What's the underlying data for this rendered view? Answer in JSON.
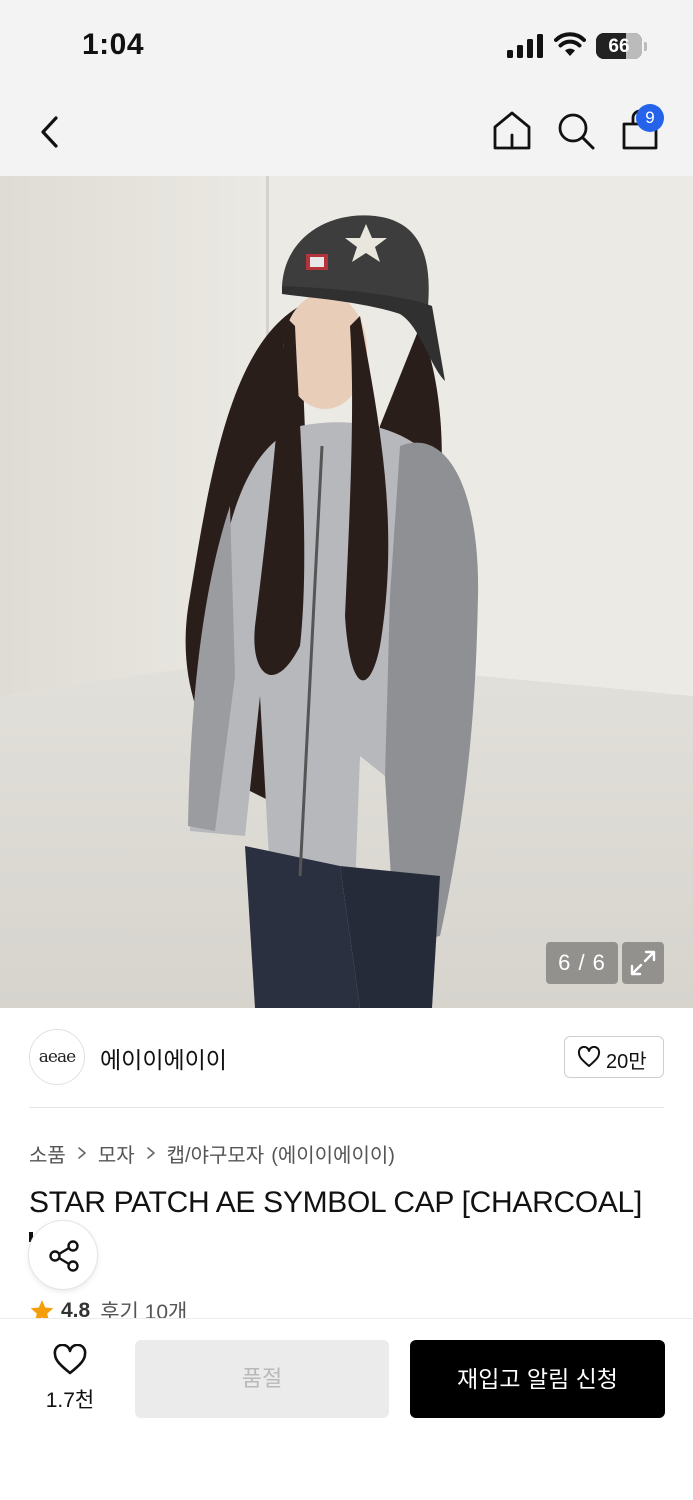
{
  "status_bar": {
    "time": "1:04",
    "battery_percent": 66,
    "battery_label": "66",
    "signal_bars": 4,
    "wifi": "wifi-icon"
  },
  "nav": {
    "back_icon": "chevron-left-icon",
    "home_icon": "home-icon",
    "search_icon": "search-icon",
    "cart_icon": "shopping-bag-icon",
    "cart_count": "9",
    "badge_color": "#2563eb"
  },
  "gallery": {
    "counter": "6 / 6",
    "current_index": 6,
    "total": 6,
    "expand_icon": "expand-icon"
  },
  "brand": {
    "logo_text": "aeae",
    "name": "에이이에이이",
    "like_count": "20만",
    "heart_icon": "heart-outline-icon"
  },
  "breadcrumb": {
    "items": [
      "소품",
      "모자",
      "캡/야구모자"
    ],
    "brand_suffix": "(에이이에이이)"
  },
  "product": {
    "title": "STAR PATCH AE SYMBOL CAP [CHARCOAL]",
    "rating": "4.8",
    "review_label": "후기 10개",
    "star_color": "#f59e0b"
  },
  "share": {
    "icon": "share-icon"
  },
  "bottom_bar": {
    "wish_count": "1.7천",
    "soldout_label": "품절",
    "restock_label": "재입고 알림 신청"
  }
}
